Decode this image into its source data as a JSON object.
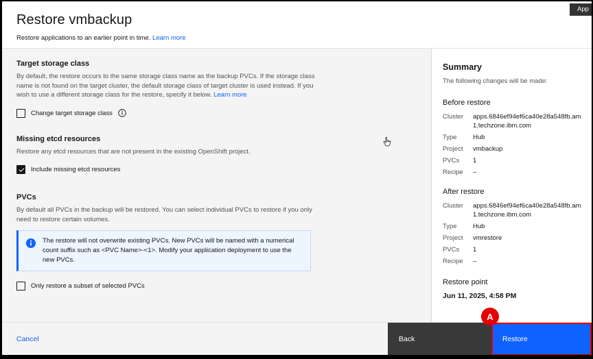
{
  "tooltip": {
    "label": "App"
  },
  "header": {
    "title": "Restore vmbackup",
    "subtitle": "Restore applications to an earlier point in time.",
    "learn_more": "Learn more"
  },
  "sections": {
    "storage": {
      "heading": "Target storage class",
      "body": "By default, the restore occurs to the same storage class name as the backup PVCs. If the storage class name is not found on the target cluster, the default storage class of target cluster is used instead. If you wish to use a different storage class for the restore, specify it below.",
      "learn_more": "Learn more",
      "checkbox_label": "Change target storage class",
      "checked": false
    },
    "etcd": {
      "heading": "Missing etcd resources",
      "body": "Restore any etcd resources that are not present in the existing OpenShift project.",
      "checkbox_label": "Include missing etcd resources",
      "checked": true
    },
    "pvcs": {
      "heading": "PVCs",
      "body": "By default all PVCs in the backup will be restored. You can select individual PVCs to restore if you only need to restore certain volumes.",
      "notification": "The restore will not overwrite existing PVCs. New PVCs will be named with a numerical count suffix such as <PVC Name>-<1>. Modify your application deployment to use the new PVCs.",
      "checkbox_label": "Only restore a subset of selected PVCs",
      "checked": false
    }
  },
  "summary": {
    "heading": "Summary",
    "intro": "The following changes will be made:",
    "before": {
      "heading": "Before restore",
      "rows": [
        {
          "label": "Cluster",
          "value": "apps.6846ef94ef6ca40e28a548fb.am1.techzone.ibm.com"
        },
        {
          "label": "Type",
          "value": "Hub"
        },
        {
          "label": "Project",
          "value": "vmbackup"
        },
        {
          "label": "PVCs",
          "value": "1"
        },
        {
          "label": "Recipe",
          "value": "–"
        }
      ]
    },
    "after": {
      "heading": "After restore",
      "rows": [
        {
          "label": "Cluster",
          "value": "apps.6846ef94ef6ca40e28a548fb.am1.techzone.ibm.com"
        },
        {
          "label": "Type",
          "value": "Hub"
        },
        {
          "label": "Project",
          "value": "vmrestore"
        },
        {
          "label": "PVCs",
          "value": "1"
        },
        {
          "label": "Recipe",
          "value": "–"
        }
      ]
    },
    "restore_point": {
      "heading": "Restore point",
      "value": "Jun 11, 2025, 4:58 PM"
    }
  },
  "footer": {
    "cancel_label": "Cancel",
    "back_label": "Back",
    "restore_label": "Restore"
  },
  "annotation": {
    "label": "A",
    "color": "#e60000"
  },
  "icons": {
    "info_outline": "ⓘ"
  },
  "colors": {
    "accent_blue": "#0f62fe",
    "annotation_red": "#e60000",
    "back_button_gray": "#393939",
    "content_bg": "#f4f4f4",
    "notification_bg": "#edf5ff"
  }
}
